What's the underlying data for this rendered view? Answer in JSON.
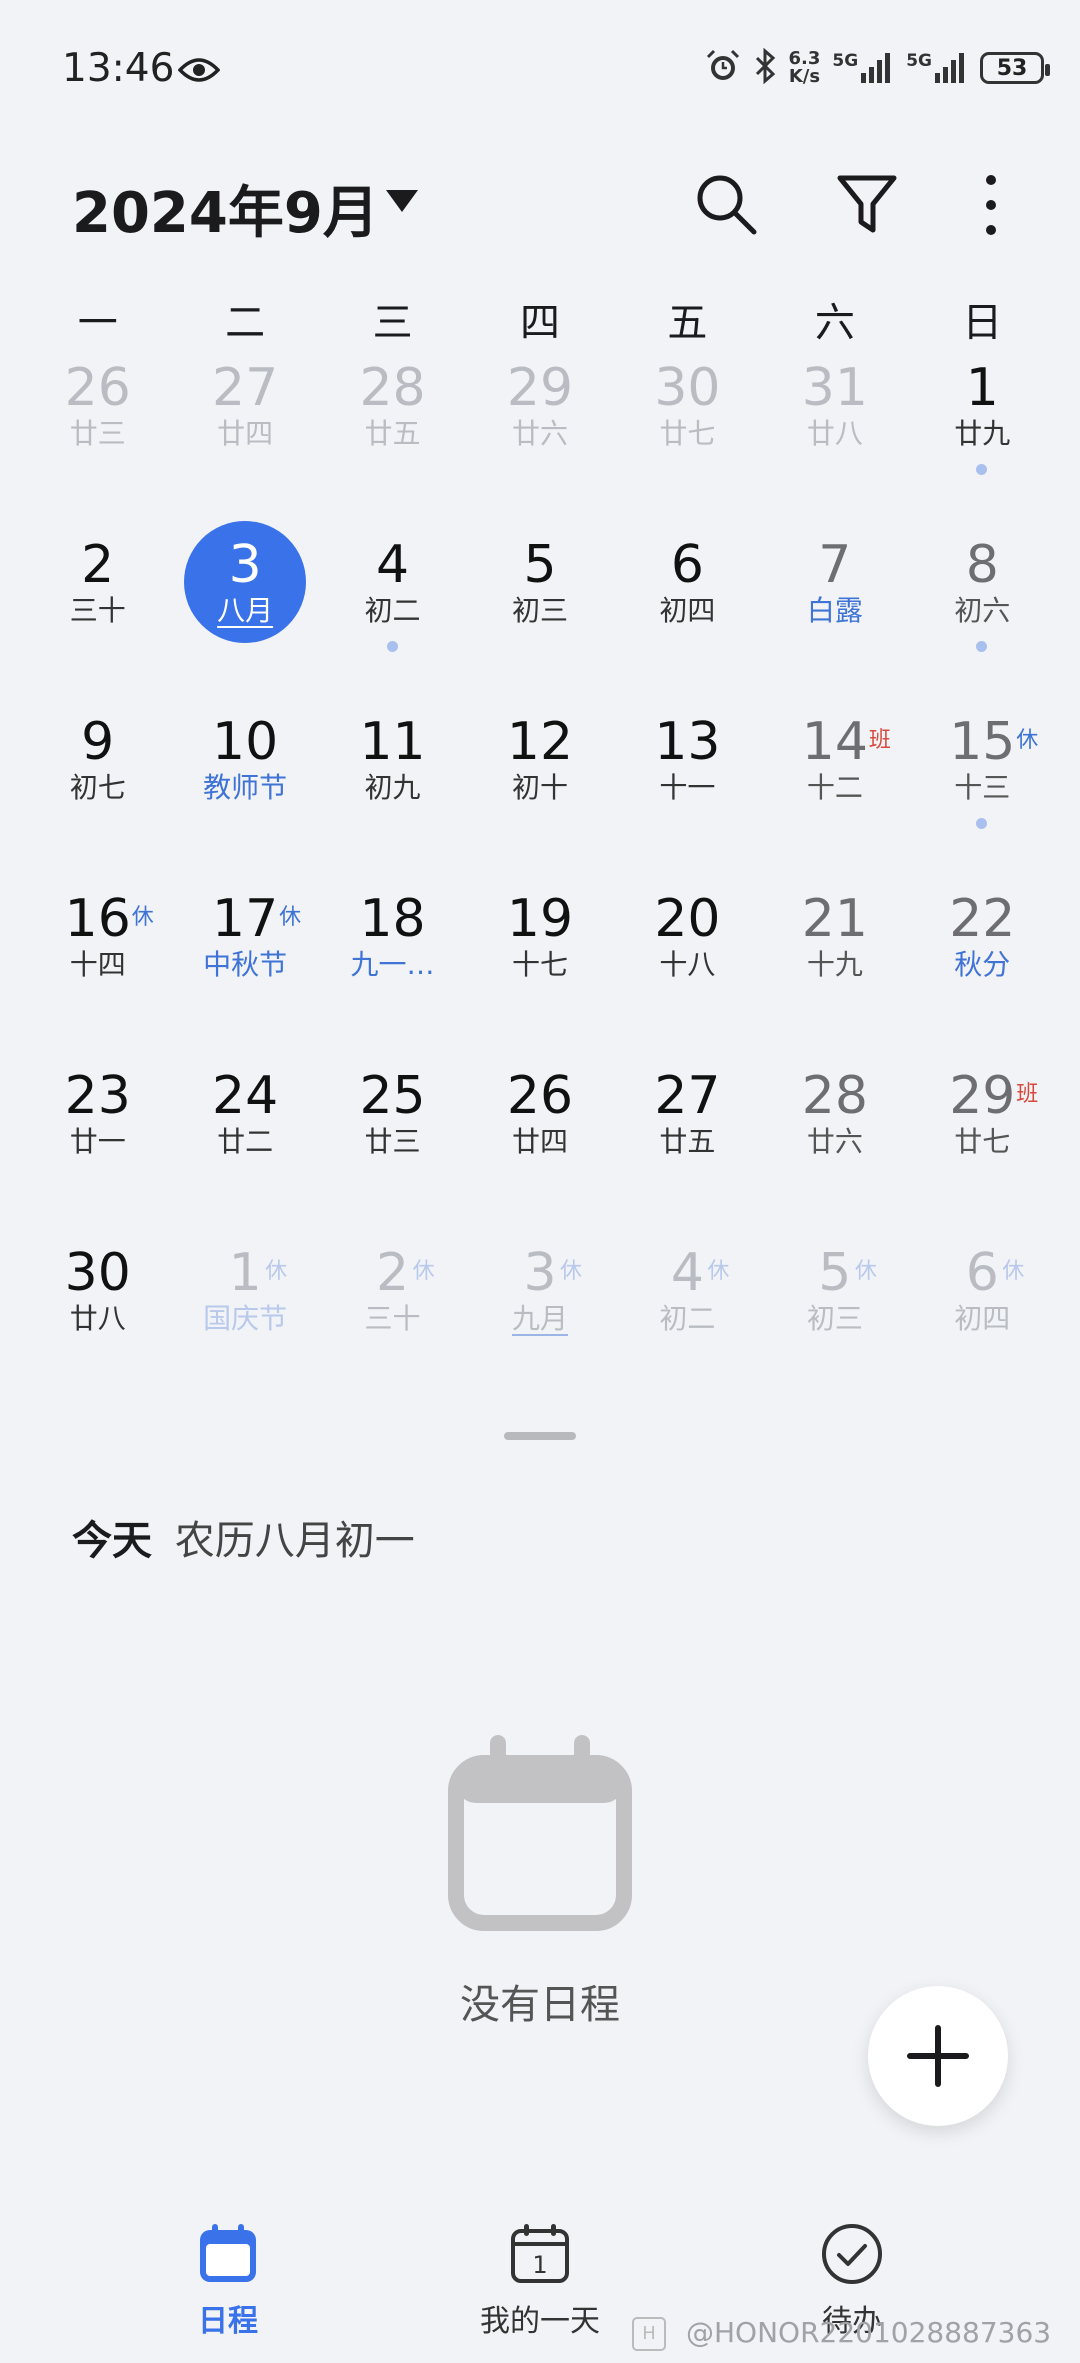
{
  "status_bar": {
    "time": "13:46",
    "net_speed_value": "6.3",
    "net_speed_unit": "K/s",
    "sim1": "5G",
    "sim2": "5G",
    "battery": "53"
  },
  "header": {
    "month_title": "2024年9月",
    "icons": [
      "search-icon",
      "filter-icon",
      "more-icon"
    ]
  },
  "weekdays": [
    "一",
    "二",
    "三",
    "四",
    "五",
    "六",
    "日"
  ],
  "days": [
    {
      "num": "26",
      "sub": "廿三",
      "kind": "muted"
    },
    {
      "num": "27",
      "sub": "廿四",
      "kind": "muted"
    },
    {
      "num": "28",
      "sub": "廿五",
      "kind": "muted"
    },
    {
      "num": "29",
      "sub": "廿六",
      "kind": "muted"
    },
    {
      "num": "30",
      "sub": "廿七",
      "kind": "muted"
    },
    {
      "num": "31",
      "sub": "廿八",
      "kind": "muted"
    },
    {
      "num": "1",
      "sub": "廿九",
      "kind": "normal",
      "dot": true
    },
    {
      "num": "2",
      "sub": "三十",
      "kind": "normal"
    },
    {
      "num": "3",
      "sub": "八月",
      "kind": "selected"
    },
    {
      "num": "4",
      "sub": "初二",
      "kind": "normal",
      "dot": true
    },
    {
      "num": "5",
      "sub": "初三",
      "kind": "normal"
    },
    {
      "num": "6",
      "sub": "初四",
      "kind": "normal"
    },
    {
      "num": "7",
      "sub": "白露",
      "kind": "weekend",
      "festival": true
    },
    {
      "num": "8",
      "sub": "初六",
      "kind": "weekend",
      "dot": true
    },
    {
      "num": "9",
      "sub": "初七",
      "kind": "normal"
    },
    {
      "num": "10",
      "sub": "教师节",
      "kind": "normal",
      "festival": true
    },
    {
      "num": "11",
      "sub": "初九",
      "kind": "normal"
    },
    {
      "num": "12",
      "sub": "初十",
      "kind": "normal"
    },
    {
      "num": "13",
      "sub": "十一",
      "kind": "normal"
    },
    {
      "num": "14",
      "sub": "十二",
      "kind": "weekend",
      "badge": "班",
      "badge_type": "work"
    },
    {
      "num": "15",
      "sub": "十三",
      "kind": "weekend",
      "badge": "休",
      "dot": true
    },
    {
      "num": "16",
      "sub": "十四",
      "kind": "normal",
      "badge": "休"
    },
    {
      "num": "17",
      "sub": "中秋节",
      "kind": "normal",
      "festival": true,
      "badge": "休"
    },
    {
      "num": "18",
      "sub": "九一…",
      "kind": "normal",
      "festival": true
    },
    {
      "num": "19",
      "sub": "十七",
      "kind": "normal"
    },
    {
      "num": "20",
      "sub": "十八",
      "kind": "normal"
    },
    {
      "num": "21",
      "sub": "十九",
      "kind": "weekend"
    },
    {
      "num": "22",
      "sub": "秋分",
      "kind": "weekend",
      "festival": true
    },
    {
      "num": "23",
      "sub": "廿一",
      "kind": "normal"
    },
    {
      "num": "24",
      "sub": "廿二",
      "kind": "normal"
    },
    {
      "num": "25",
      "sub": "廿三",
      "kind": "normal"
    },
    {
      "num": "26",
      "sub": "廿四",
      "kind": "normal"
    },
    {
      "num": "27",
      "sub": "廿五",
      "kind": "normal"
    },
    {
      "num": "28",
      "sub": "廿六",
      "kind": "weekend"
    },
    {
      "num": "29",
      "sub": "廿七",
      "kind": "weekend",
      "badge": "班",
      "badge_type": "work"
    },
    {
      "num": "30",
      "sub": "廿八",
      "kind": "normal"
    },
    {
      "num": "1",
      "sub": "国庆节",
      "kind": "muted",
      "festival": true,
      "badge": "休"
    },
    {
      "num": "2",
      "sub": "三十",
      "kind": "muted",
      "badge": "休"
    },
    {
      "num": "3",
      "sub": "九月",
      "kind": "muted",
      "badge": "休",
      "underline": true
    },
    {
      "num": "4",
      "sub": "初二",
      "kind": "muted",
      "badge": "休"
    },
    {
      "num": "5",
      "sub": "初三",
      "kind": "muted",
      "badge": "休"
    },
    {
      "num": "6",
      "sub": "初四",
      "kind": "muted",
      "badge": "休"
    }
  ],
  "today": {
    "label": "今天",
    "lunar": "农历八月初一"
  },
  "empty_state": {
    "text": "没有日程",
    "icon": "calendar-empty-icon"
  },
  "fab_icon": "plus-icon",
  "nav": [
    {
      "label": "日程",
      "icon": "calendar-icon",
      "active": true
    },
    {
      "label": "我的一天",
      "icon": "day-calendar-icon",
      "day_number": "1",
      "active": false
    },
    {
      "label": "待办",
      "icon": "check-circle-icon",
      "active": false
    }
  ],
  "watermark": "@HONOR2201028887363",
  "colors": {
    "accent": "#3a72ea",
    "festival": "#3f73d6",
    "work_badge": "#d84a3d",
    "background": "#f1f3f6"
  }
}
